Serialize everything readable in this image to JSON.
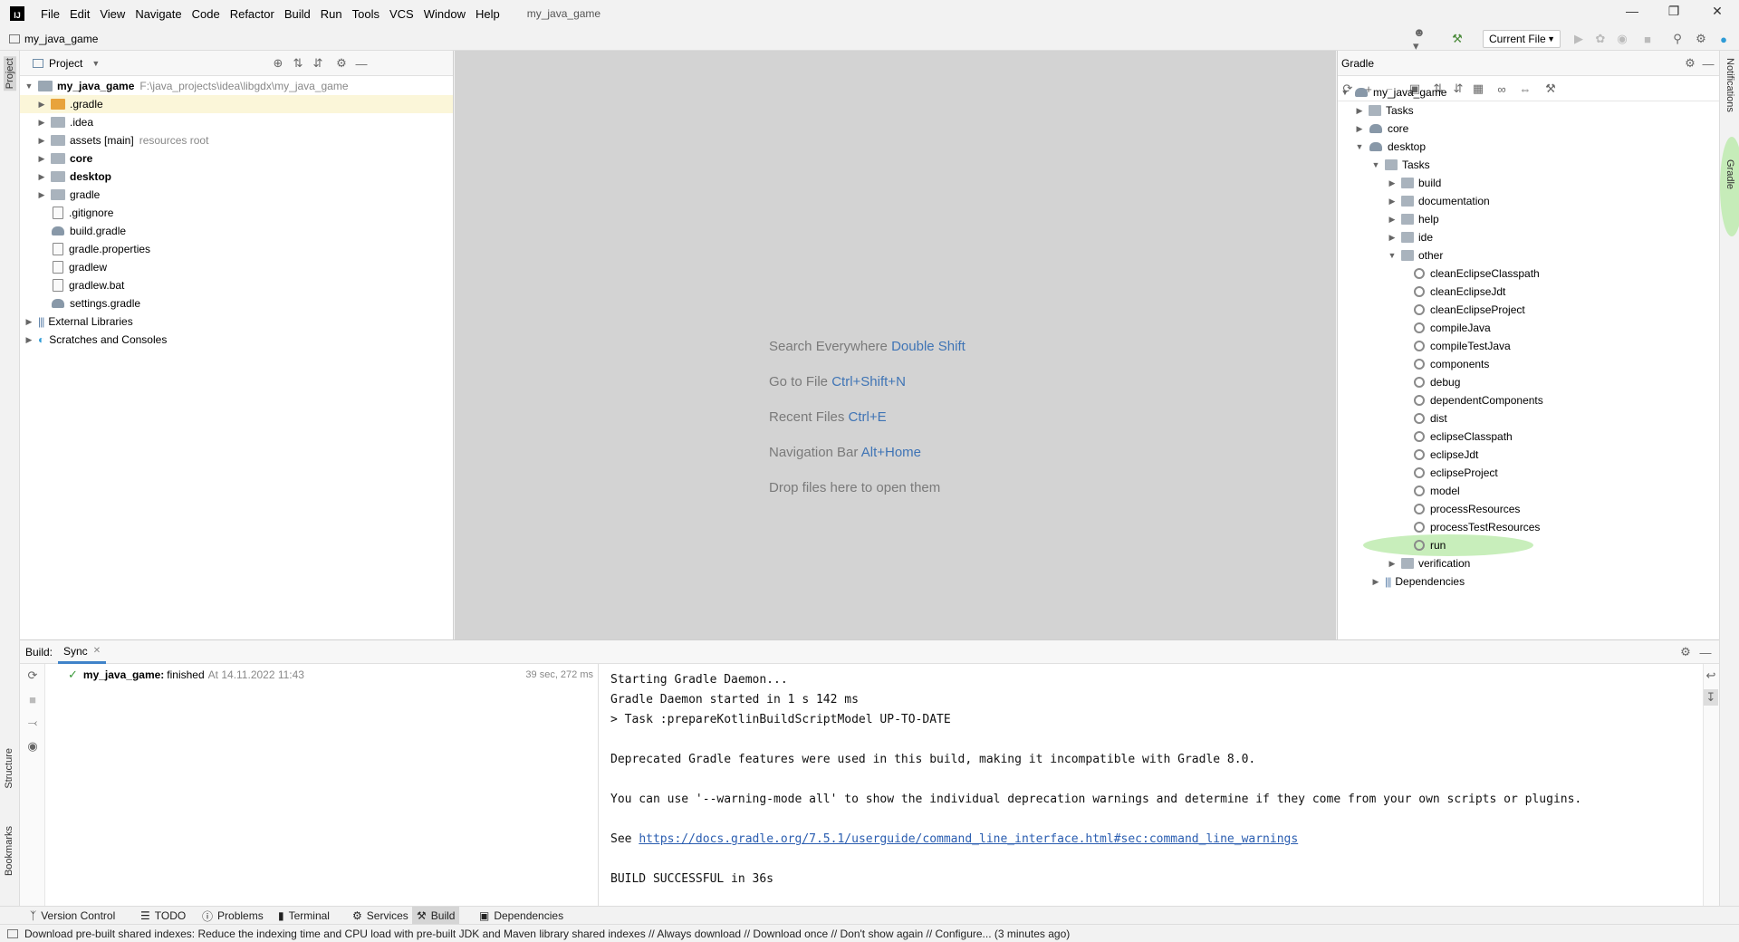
{
  "menu": {
    "items": [
      "File",
      "Edit",
      "View",
      "Navigate",
      "Code",
      "Refactor",
      "Build",
      "Run",
      "Tools",
      "VCS",
      "Window",
      "Help"
    ],
    "window_title": "my_java_game"
  },
  "navbar": {
    "breadcrumb": "my_java_game",
    "run_config": "Current File"
  },
  "left_stripe": {
    "project": "Project",
    "structure": "Structure",
    "bookmarks": "Bookmarks"
  },
  "right_stripe": {
    "notifications": "Notifications",
    "gradle": "Gradle"
  },
  "project_panel": {
    "title": "Project",
    "root": {
      "name": "my_java_game",
      "path": "F:\\java_projects\\idea\\libgdx\\my_java_game"
    },
    "items": [
      {
        "label": ".gradle"
      },
      {
        "label": ".idea"
      },
      {
        "label": "assets [main]",
        "suffix": "resources root"
      },
      {
        "label": "core"
      },
      {
        "label": "desktop"
      },
      {
        "label": "gradle"
      },
      {
        "label": ".gitignore"
      },
      {
        "label": "build.gradle"
      },
      {
        "label": "gradle.properties"
      },
      {
        "label": "gradlew"
      },
      {
        "label": "gradlew.bat"
      },
      {
        "label": "settings.gradle"
      },
      {
        "label": "External Libraries"
      },
      {
        "label": "Scratches and Consoles"
      }
    ]
  },
  "editor_hints": [
    {
      "text": "Search Everywhere",
      "key": "Double Shift"
    },
    {
      "text": "Go to File",
      "key": "Ctrl+Shift+N"
    },
    {
      "text": "Recent Files",
      "key": "Ctrl+E"
    },
    {
      "text": "Navigation Bar",
      "key": "Alt+Home"
    },
    {
      "text": "Drop files here to open them",
      "key": ""
    }
  ],
  "gradle_panel": {
    "title": "Gradle",
    "tree": [
      "my_java_game",
      "Tasks",
      "core",
      "desktop",
      "Tasks",
      "build",
      "documentation",
      "help",
      "ide",
      "other",
      "cleanEclipseClasspath",
      "cleanEclipseJdt",
      "cleanEclipseProject",
      "compileJava",
      "compileTestJava",
      "components",
      "debug",
      "dependentComponents",
      "dist",
      "eclipseClasspath",
      "eclipseJdt",
      "eclipseProject",
      "model",
      "processResources",
      "processTestResources",
      "run",
      "verification",
      "Dependencies"
    ]
  },
  "build_panel": {
    "label": "Build:",
    "tab": "Sync",
    "result": {
      "name": "my_java_game:",
      "status": "finished",
      "time": "At 14.11.2022 11:43",
      "duration": "39 sec, 272 ms"
    },
    "console": [
      "Starting Gradle Daemon...",
      "Gradle Daemon started in 1 s 142 ms",
      "> Task :prepareKotlinBuildScriptModel UP-TO-DATE",
      "Deprecated Gradle features were used in this build, making it incompatible with Gradle 8.0.",
      "You can use '--warning-mode all' to show the individual deprecation warnings and determine if they come from your own scripts or plugins.",
      "See",
      "https://docs.gradle.org/7.5.1/userguide/command_line_interface.html#sec:command_line_warnings",
      "BUILD SUCCESSFUL in 36s"
    ]
  },
  "bottom_tabs": [
    "Version Control",
    "TODO",
    "Problems",
    "Terminal",
    "Services",
    "Build",
    "Dependencies"
  ],
  "status": "Download pre-built shared indexes: Reduce the indexing time and CPU load with pre-built JDK and Maven library shared indexes // Always download // Download once // Don't show again // Configure... (3 minutes ago)"
}
